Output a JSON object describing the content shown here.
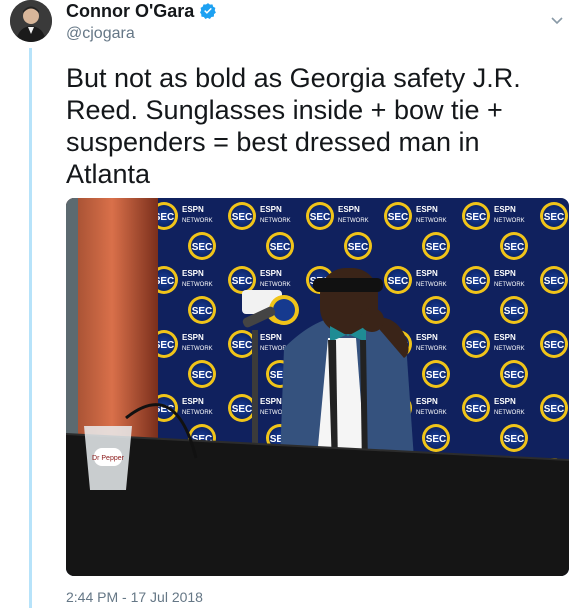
{
  "tweet": {
    "author": {
      "display_name": "Connor O'Gara",
      "handle": "@cjogara",
      "verified": true
    },
    "text": "But not as bold as Georgia safety J.R. Reed. Sunglasses inside + bow tie + suspenders = best dressed man in Atlanta",
    "timestamp": "2:44 PM - 17 Jul 2018",
    "media": {
      "kind": "photo",
      "backdrop_labels": [
        "SEC",
        "ESPN",
        "NETWORK"
      ],
      "cup_label": "Dr Pepper"
    }
  },
  "icons": {
    "verified": "verified-badge-icon",
    "caret": "chevron-down-icon"
  },
  "colors": {
    "name": "#14171a",
    "secondary": "#657786",
    "thread_line": "#b7e3fa",
    "verified": "#1da1f2"
  }
}
